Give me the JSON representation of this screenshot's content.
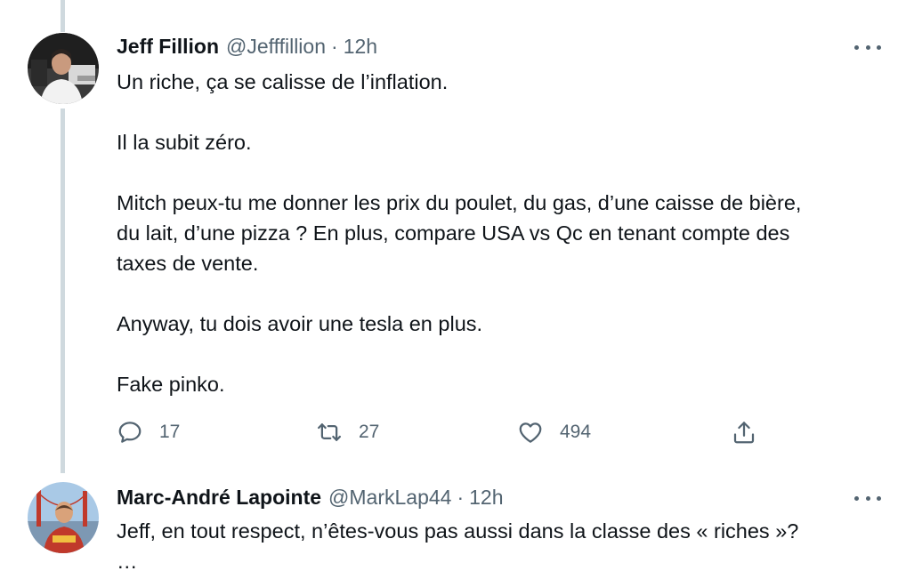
{
  "tweets": [
    {
      "name": "Jeff Fillion",
      "handle": "@Jefffillion",
      "separator": "·",
      "time": "12h",
      "paragraphs": [
        [
          "Un riche, ça se calisse de l’inflation."
        ],
        [
          "Il la subit zéro."
        ],
        [
          "Mitch peux-tu me donner les prix du poulet, du gas, d’une caisse de bière,",
          "du lait, d’une pizza ? En plus, compare USA vs Qc en tenant compte des",
          "taxes de vente."
        ],
        [
          "Anyway, tu dois avoir une tesla en plus."
        ],
        [
          "Fake pinko."
        ]
      ],
      "actions": {
        "reply_count": "17",
        "retweet_count": "27",
        "like_count": "494"
      }
    },
    {
      "name": "Marc-André Lapointe",
      "handle": "@MarkLap44",
      "separator": "·",
      "time": "12h",
      "paragraphs": [
        [
          "Jeff, en tout respect, n’êtes-vous pas aussi dans la classe des « riches »?",
          "…"
        ]
      ]
    }
  ],
  "icons": {
    "reply": "reply-bubble-icon",
    "retweet": "retweet-icon",
    "like": "heart-icon",
    "share": "share-icon",
    "more": "more-dots-icon"
  },
  "colors": {
    "text_primary": "#0f1419",
    "text_secondary": "#536471",
    "thread_line": "#cfd9de"
  }
}
